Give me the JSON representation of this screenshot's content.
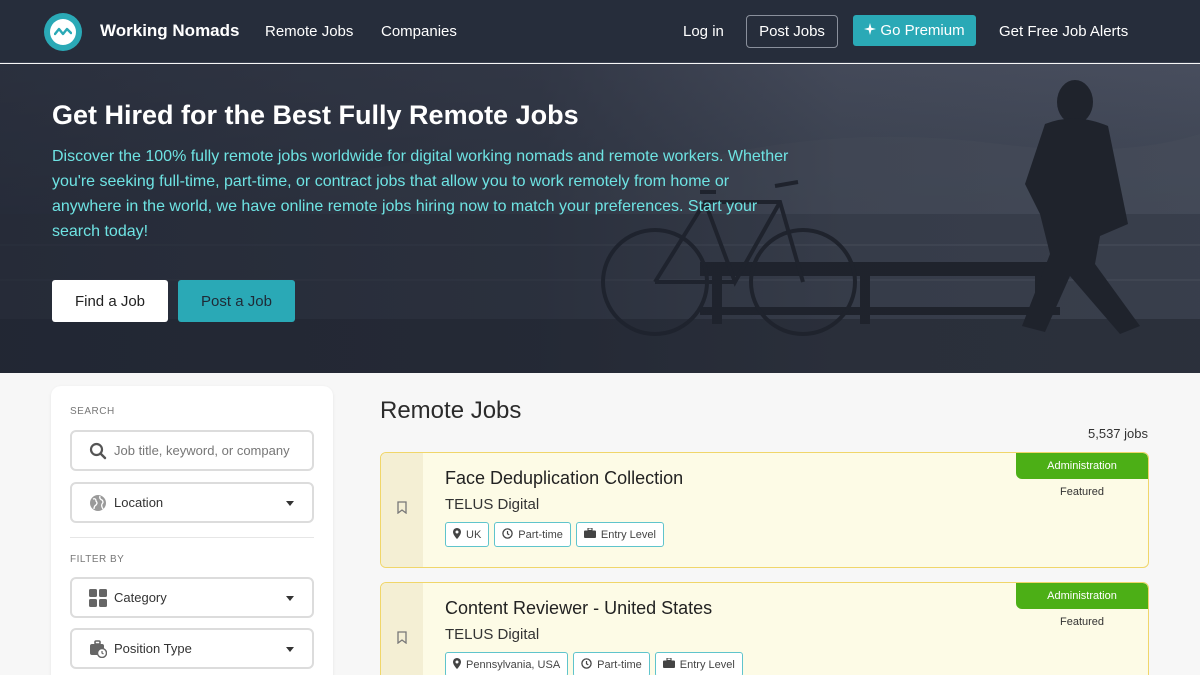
{
  "nav": {
    "brand": "Working Nomads",
    "links": [
      "Remote Jobs",
      "Companies"
    ],
    "login": "Log in",
    "post_jobs": "Post Jobs",
    "premium": "Go Premium",
    "alerts": "Get Free Job Alerts"
  },
  "hero": {
    "title": "Get Hired for the Best Fully Remote Jobs",
    "description": "Discover the 100% fully remote jobs worldwide for digital working nomads and remote workers. Whether you're seeking full-time, part-time, or contract jobs that allow you to work remotely from home or anywhere in the world, we have online remote jobs hiring now to match your preferences. Start your search today!",
    "find_button": "Find a Job",
    "post_button": "Post a Job"
  },
  "sidebar": {
    "search_label": "SEARCH",
    "search_placeholder": "Job title, keyword, or company",
    "location_label": "Location",
    "filter_label": "FILTER BY",
    "category_label": "Category",
    "position_type_label": "Position Type"
  },
  "main": {
    "title": "Remote Jobs",
    "job_count": "5,537 jobs",
    "jobs": [
      {
        "title": "Face Deduplication Collection",
        "company": "TELUS Digital",
        "location": "UK",
        "type": "Part-time",
        "level": "Entry Level",
        "category": "Administration",
        "featured": "Featured"
      },
      {
        "title": "Content Reviewer - United States",
        "company": "TELUS Digital",
        "location": "Pennsylvania, USA",
        "type": "Part-time",
        "level": "Entry Level",
        "category": "Administration",
        "featured": "Featured"
      }
    ]
  },
  "colors": {
    "nav_bg": "#262d3b",
    "accent": "#2aa9b6",
    "hero_text": "#6ee3e3",
    "category_badge": "#4caf16",
    "featured_card_bg": "#fdfbe6",
    "featured_card_border": "#f0d66a"
  },
  "icons": {
    "logo": "wave-logo-icon",
    "premium": "sparkle-icon",
    "search": "search-icon",
    "location": "globe-icon",
    "category": "grid-icon",
    "position_type": "briefcase-clock-icon",
    "bookmark": "bookmark-icon",
    "tag_location": "map-pin-icon",
    "tag_type": "clock-icon",
    "tag_level": "briefcase-icon"
  }
}
